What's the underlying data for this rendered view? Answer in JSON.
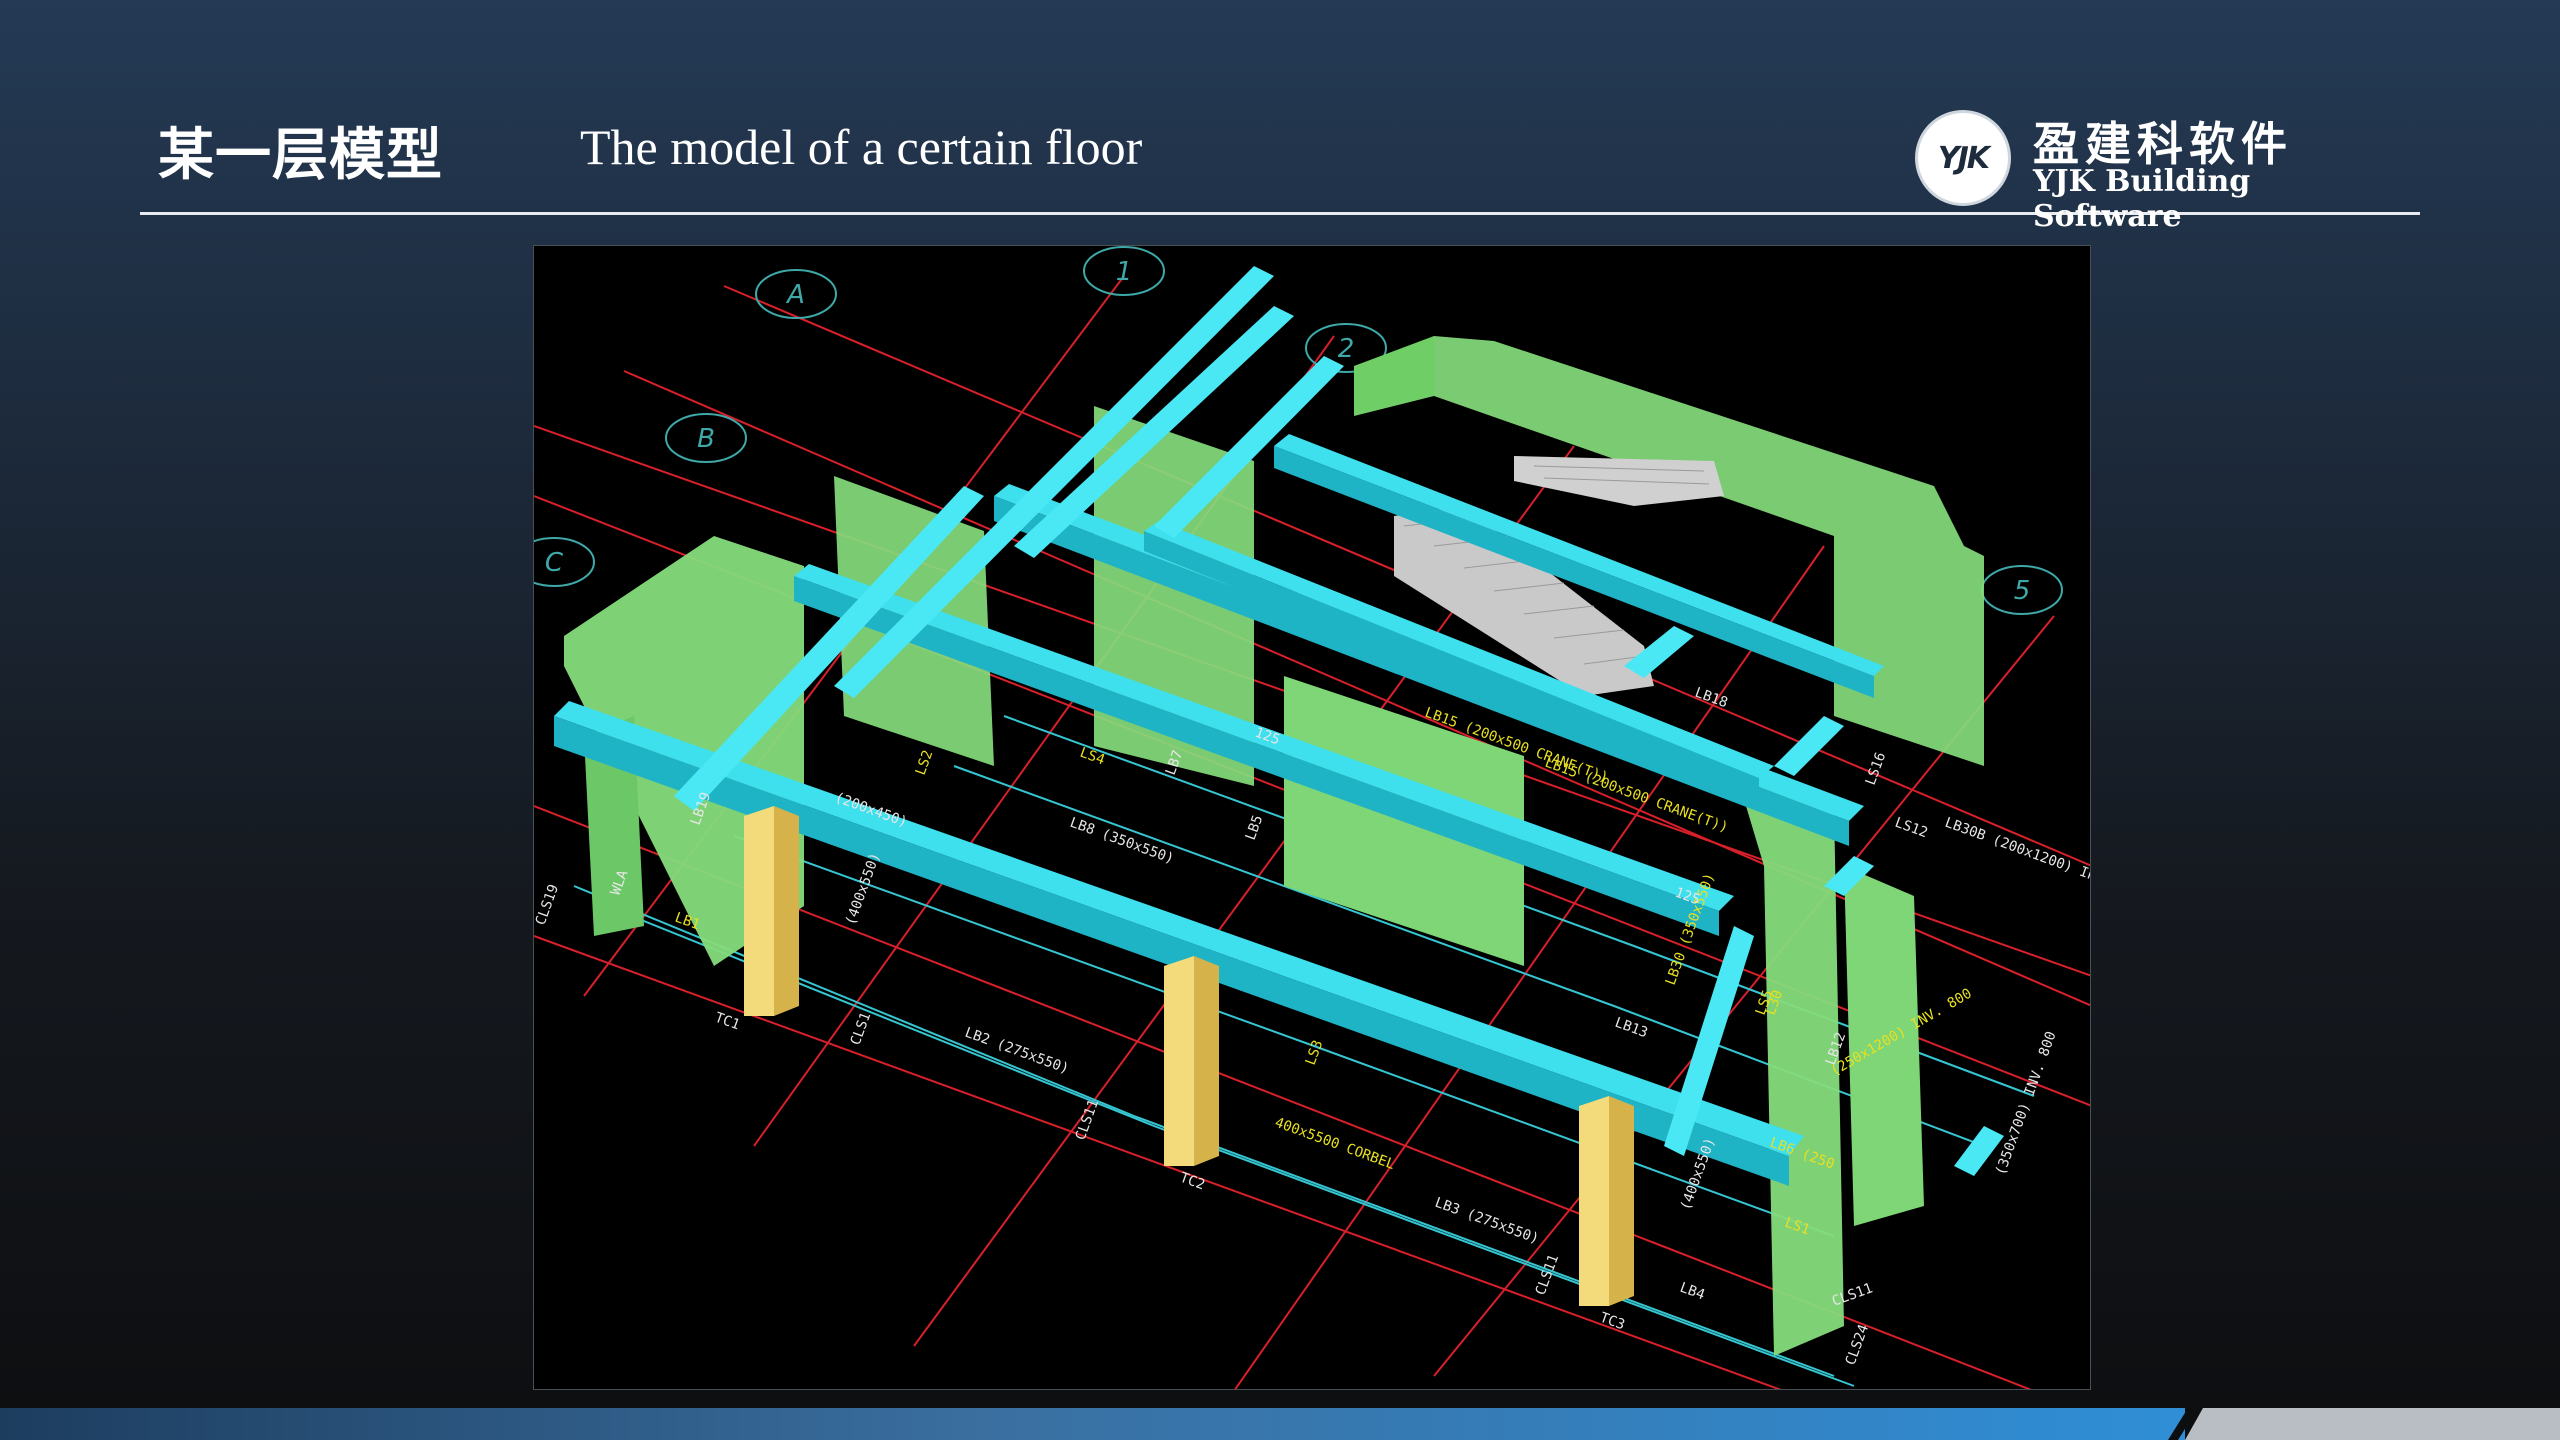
{
  "header": {
    "title_cn": "某一层模型",
    "title_en": "The model of  a certain floor"
  },
  "brand": {
    "logo_text": "YJK",
    "name_cn": "盈建科软件",
    "name_en": "YJK Building Software"
  },
  "model_view": {
    "grid_labels": [
      "A",
      "B",
      "C",
      "1",
      "2",
      "5"
    ],
    "column_labels": [
      "TC1",
      "TC2",
      "TC3"
    ],
    "wall_labels": [
      "CLS19",
      "CLS24",
      "WLA",
      "LS12",
      "LS16"
    ],
    "beam_labels": [
      "LB1",
      "LB2 (275x550)",
      "LB3 (275x550)",
      "LB4",
      "LB5",
      "LB6 (250",
      "LB7",
      "LB8 (350x550)",
      "LB12",
      "LB13",
      "LB15 (200x500 CRANE(T))",
      "LB15 (200x500 CRANE(T))",
      "LB18",
      "LB19",
      "LB30B (200x1200) INV. 850",
      "LB30 (350x550)",
      "(400x550)",
      "(400x550)",
      "(250x1200) INV. 800",
      "(350x700) INV. 800"
    ],
    "misc_labels": [
      "LS1",
      "LS2",
      "LS3",
      "LS4",
      "LS5",
      "CLS1",
      "CLS11",
      "CLS11",
      "CLS11",
      "400x5500 CORBEL",
      "125",
      "125",
      "(200x450)",
      "L30"
    ],
    "colors": {
      "beam": "#3ee0ee",
      "beam_shade": "#1fb3c6",
      "wall": "#86dc7c",
      "wall_shade": "#5fbf58",
      "column": "#f3da7a",
      "column_shade": "#d5b24a",
      "stair": "#c9c9c9",
      "grid": "#d8202a",
      "annotation": "#e6e6e6",
      "annotation_yellow": "#e8e020",
      "grid_bubble": "#3fa8a8"
    }
  },
  "footer": {
    "accent": "#2f8ed6",
    "secondary": "#b9bec4"
  }
}
